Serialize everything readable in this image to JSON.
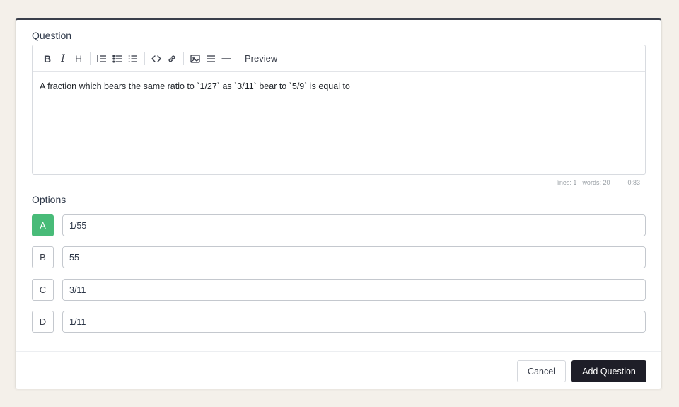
{
  "question": {
    "label": "Question",
    "toolbar": {
      "bold_label": "B",
      "italic_label": "I",
      "heading_label": "H",
      "preview_label": "Preview"
    },
    "text": "A fraction which bears the same ratio to `1/27` as `3/11` bear to `5/9` is equal to",
    "status": {
      "lines": "lines: 1",
      "words": "words: 20",
      "cursor": "0:83"
    }
  },
  "options": {
    "label": "Options",
    "items": [
      {
        "letter": "A",
        "value": "1/55",
        "correct": true
      },
      {
        "letter": "B",
        "value": "55",
        "correct": false
      },
      {
        "letter": "C",
        "value": "3/11",
        "correct": false
      },
      {
        "letter": "D",
        "value": "1/11",
        "correct": false
      }
    ]
  },
  "footer": {
    "cancel_label": "Cancel",
    "add_label": "Add Question"
  },
  "colors": {
    "correct": "#48bb78",
    "primary_button": "#1e1e28",
    "background": "#f4f0ea"
  }
}
